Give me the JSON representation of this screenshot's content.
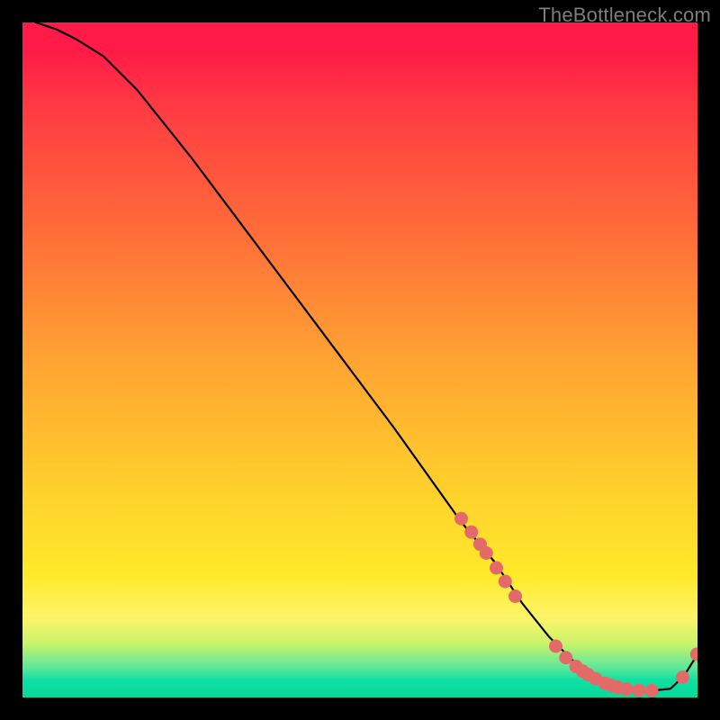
{
  "watermark": "TheBottleneck.com",
  "chart_data": {
    "type": "line",
    "title": "",
    "xlabel": "",
    "ylabel": "",
    "xlim": [
      0,
      100
    ],
    "ylim": [
      0,
      100
    ],
    "series": [
      {
        "name": "curve",
        "x": [
          2,
          5,
          8,
          12,
          17,
          25,
          40,
          55,
          65,
          70,
          74,
          78,
          82,
          86,
          90,
          93,
          96,
          98,
          100
        ],
        "y": [
          100,
          99,
          97.5,
          95,
          90,
          80,
          60,
          40,
          26,
          20,
          14,
          9,
          5,
          2.2,
          1.2,
          1,
          1.3,
          3.2,
          6.4
        ]
      }
    ],
    "markers": [
      {
        "x": 65.0,
        "y": 26.5
      },
      {
        "x": 66.5,
        "y": 24.5
      },
      {
        "x": 67.8,
        "y": 22.7
      },
      {
        "x": 68.7,
        "y": 21.4
      },
      {
        "x": 70.2,
        "y": 19.2
      },
      {
        "x": 71.5,
        "y": 17.2
      },
      {
        "x": 73.0,
        "y": 15.0
      },
      {
        "x": 79.0,
        "y": 7.6
      },
      {
        "x": 80.5,
        "y": 5.9
      },
      {
        "x": 82.0,
        "y": 4.6
      },
      {
        "x": 83.0,
        "y": 3.9
      },
      {
        "x": 83.8,
        "y": 3.4
      },
      {
        "x": 84.9,
        "y": 2.8
      },
      {
        "x": 86.3,
        "y": 2.1
      },
      {
        "x": 87.2,
        "y": 1.8
      },
      {
        "x": 88.2,
        "y": 1.5
      },
      {
        "x": 89.5,
        "y": 1.25
      },
      {
        "x": 91.3,
        "y": 1.05
      },
      {
        "x": 93.2,
        "y": 1.02
      },
      {
        "x": 97.8,
        "y": 3.0
      },
      {
        "x": 99.9,
        "y": 6.4
      }
    ],
    "gradient_stops": [
      {
        "pos": 0.0,
        "color": "#ff1a47"
      },
      {
        "pos": 0.3,
        "color": "#ff6a3a"
      },
      {
        "pos": 0.5,
        "color": "#ffa332"
      },
      {
        "pos": 0.7,
        "color": "#ffd22c"
      },
      {
        "pos": 0.88,
        "color": "#fff46a"
      },
      {
        "pos": 0.95,
        "color": "#5fe89a"
      },
      {
        "pos": 1.0,
        "color": "#05d89b"
      }
    ],
    "marker_style": {
      "shape": "circle",
      "radius": 7.5,
      "fill": "#e46a6a"
    }
  }
}
